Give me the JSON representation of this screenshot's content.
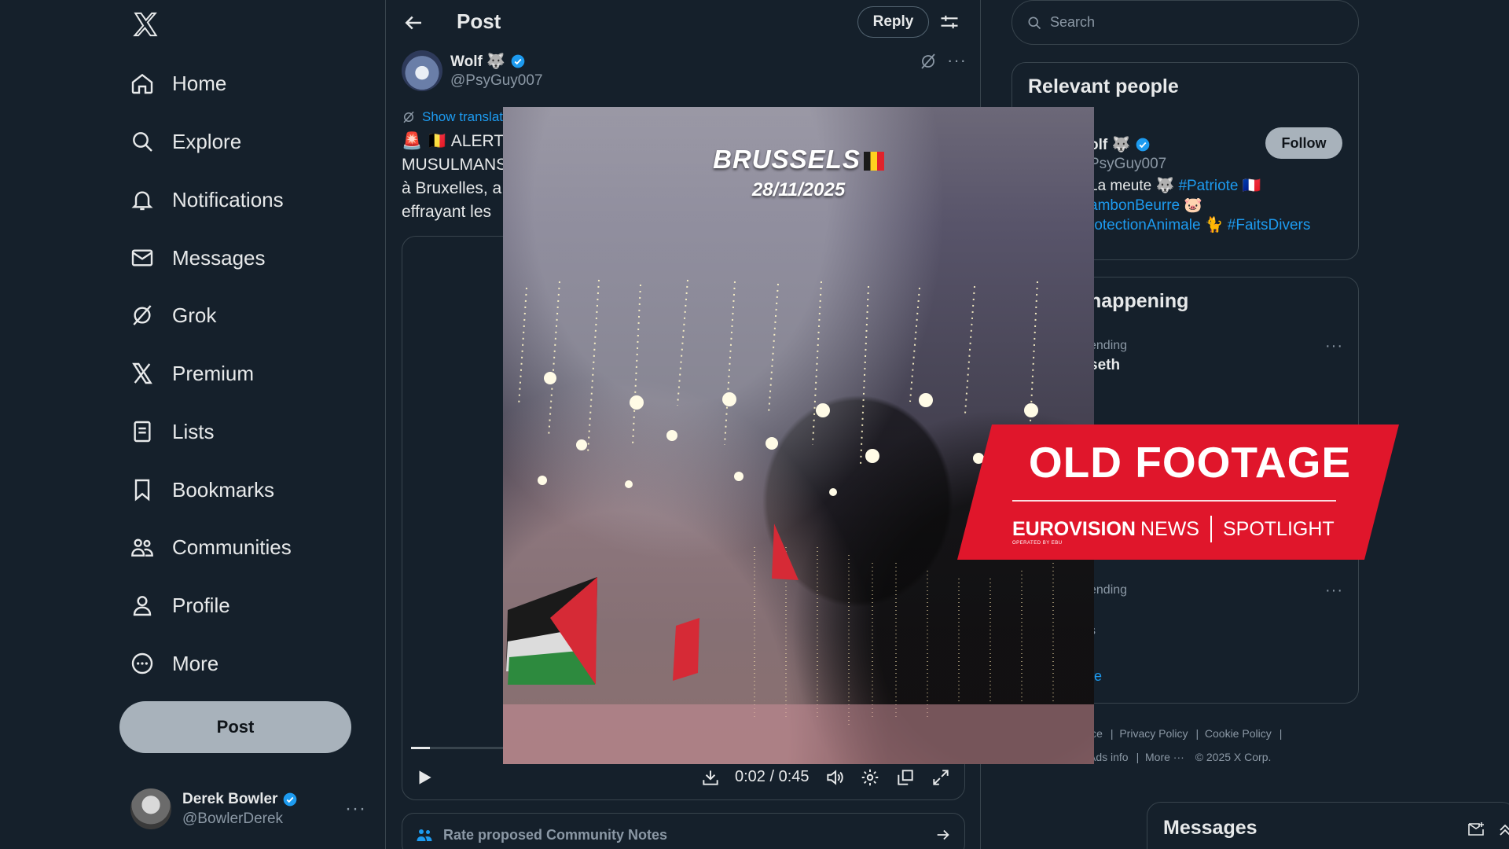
{
  "nav": {
    "items": [
      {
        "label": "Home",
        "icon": "home-icon"
      },
      {
        "label": "Explore",
        "icon": "search-icon"
      },
      {
        "label": "Notifications",
        "icon": "bell-icon"
      },
      {
        "label": "Messages",
        "icon": "mail-icon"
      },
      {
        "label": "Grok",
        "icon": "grok-icon"
      },
      {
        "label": "Premium",
        "icon": "x-icon"
      },
      {
        "label": "Lists",
        "icon": "list-icon"
      },
      {
        "label": "Bookmarks",
        "icon": "bookmark-icon"
      },
      {
        "label": "Communities",
        "icon": "people-icon"
      },
      {
        "label": "Profile",
        "icon": "person-icon"
      },
      {
        "label": "More",
        "icon": "more-circle-icon"
      }
    ],
    "post_button": "Post"
  },
  "account": {
    "name": "Derek Bowler",
    "handle": "@BowlerDerek"
  },
  "header": {
    "title": "Post",
    "reply_button": "Reply"
  },
  "tweet": {
    "author_name": "Wolf 🐺",
    "author_handle": "@PsyGuy007",
    "show_translation": "Show translat",
    "text_line1": "🚨 🇧🇪 ALERT",
    "text_line2": "MUSULMANS",
    "text_line3": "à Bruxelles, a",
    "text_line4": "effrayant les"
  },
  "video": {
    "title": "BRUSSELS",
    "date": "28/11/2025",
    "time": "0:02 / 0:45",
    "progress": 0.04
  },
  "banner": {
    "title": "OLD FOOTAGE",
    "brand_euro": "EUROVISION",
    "brand_news": "NEWS",
    "brand_spotlight": "SPOTLIGHT",
    "brand_sub": "OPERATED BY EBU"
  },
  "community_notes": {
    "label": "Rate proposed Community Notes"
  },
  "search": {
    "placeholder": "Search"
  },
  "relevant_people": {
    "title": "Relevant people",
    "name": "olf 🐺",
    "handle": "PsyGuy007",
    "follow": "Follow",
    "bio_line1_text": "La meute 🐺",
    "bio_line1_tag": "#Patriote",
    "bio_line1_flag": "🇫🇷",
    "bio_line2_tag": "ambonBeurre",
    "bio_line2_emoji": "🐷",
    "bio_line3_tag": "rotectionAnimale",
    "bio_line3_emoji": "🐈",
    "bio_line3_tag2": "#FaitsDivers"
  },
  "happening": {
    "title": "happening",
    "trend1_meta": "ending",
    "trend1_name": "seth",
    "trend2_meta": "ending",
    "trend3_meta": "s",
    "show_more": "re"
  },
  "footer": {
    "links": [
      "ice",
      "Privacy Policy",
      "Cookie Policy",
      "Ads info",
      "More ···",
      "© 2025 X Corp."
    ]
  },
  "messages_drawer": {
    "title": "Messages"
  },
  "colors": {
    "background": "#15202b",
    "accent": "#1d9bf0",
    "banner_red": "#e0162b"
  }
}
